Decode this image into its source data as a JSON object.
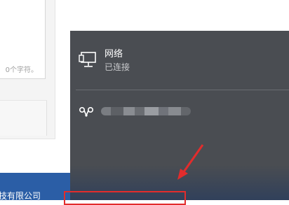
{
  "background": {
    "textarea_hint": "0个字符。",
    "footer_text": "技有限公司"
  },
  "network_flyout": {
    "connected_network": {
      "icon": "ethernet-monitor-icon",
      "name": "网络",
      "status": "已连接"
    },
    "wifi_network": {
      "icon": "wifi-hotspot-icon"
    }
  },
  "annotations": {
    "arrow_color": "#e22c2c",
    "highlight_color": "#e22c2c"
  }
}
